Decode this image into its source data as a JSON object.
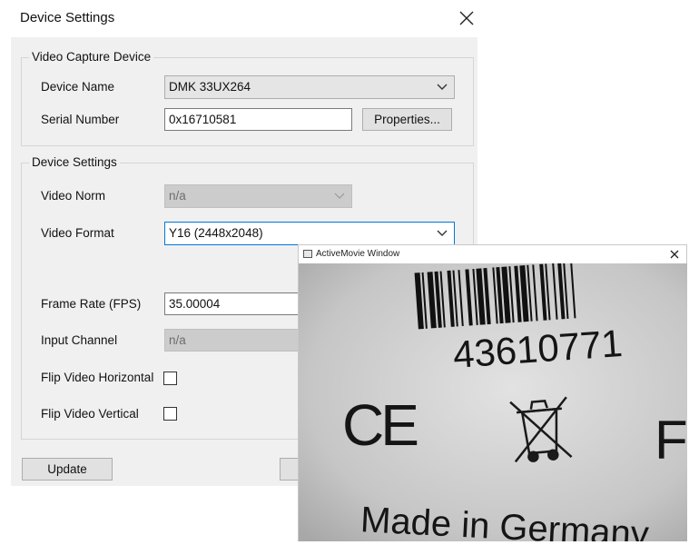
{
  "dialog": {
    "title": "Device Settings",
    "close_icon": "close-icon"
  },
  "capture_group": {
    "title": "Video Capture Device",
    "device_name_label": "Device Name",
    "device_name_value": "DMK 33UX264",
    "serial_label": "Serial Number",
    "serial_value": "0x16710581",
    "properties_button": "Properties..."
  },
  "settings_group": {
    "title": "Device Settings",
    "video_norm_label": "Video Norm",
    "video_norm_value": "n/a",
    "video_format_label": "Video Format",
    "video_format_value": "Y16 (2448x2048)",
    "frame_rate_label": "Frame Rate (FPS)",
    "frame_rate_value": "35.00004",
    "input_channel_label": "Input Channel",
    "input_channel_value": "n/a",
    "flip_h_label": "Flip Video Horizontal",
    "flip_h_checked": false,
    "flip_v_label": "Flip Video Vertical",
    "flip_v_checked": false
  },
  "footer": {
    "update_button": "Update"
  },
  "movie_window": {
    "title": "ActiveMovie Window",
    "close_icon": "close-icon",
    "image_text": {
      "number": "43610771",
      "ce_mark": "CE",
      "partial_letter": "F",
      "made_in": "Made in Germany"
    }
  }
}
